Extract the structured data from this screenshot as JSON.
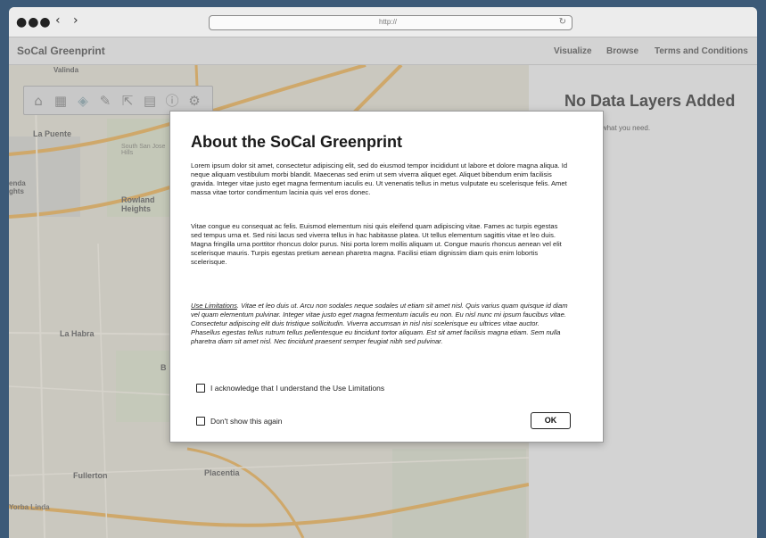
{
  "browser": {
    "dots": "●●●",
    "back": "‹",
    "forward": "›",
    "url": "http://",
    "reload_icon": "↻"
  },
  "app": {
    "title": "SoCal Greenprint",
    "nav": [
      "Visualize",
      "Browse",
      "Terms and Conditions"
    ]
  },
  "map": {
    "labels": [
      "Valinda",
      "La Puente",
      "South San Jose Hills",
      "enda ghts",
      "Rowland Heights",
      "La Habra",
      "Fullerton",
      "Placentia",
      "B",
      "Yorba Linda"
    ],
    "toolbar_icons": [
      "home-icon",
      "basemap-icon",
      "layers-icon",
      "draw-icon",
      "export-icon",
      "calculator-icon",
      "info-icon",
      "settings-icon"
    ]
  },
  "panel": {
    "title": "No Data Layers Added",
    "subtitle": "ailable datasets to find what you need."
  },
  "modal": {
    "title": "About the SoCal Greenprint",
    "para1": "Lorem ipsum dolor sit amet, consectetur adipiscing elit, sed do eiusmod tempor incididunt ut labore et dolore magna aliqua. Id neque aliquam vestibulum morbi blandit. Maecenas sed enim ut sem viverra aliquet eget. Aliquet bibendum enim facilisis gravida. Integer vitae justo eget magna fermentum iaculis eu. Ut venenatis tellus in metus vulputate eu scelerisque felis. Amet massa vitae tortor condimentum lacinia quis vel eros donec.",
    "para2": "Vitae congue eu consequat ac felis. Euismod elementum nisi quis eleifend quam adipiscing vitae. Fames ac turpis egestas sed tempus urna et. Sed nisi lacus sed viverra tellus in hac habitasse platea. Ut tellus elementum sagittis vitae et leo duis. Magna fringilla urna porttitor rhoncus dolor purus. Nisi porta lorem mollis aliquam ut. Congue mauris rhoncus aenean vel elit scelerisque mauris. Turpis egestas pretium aenean pharetra magna. Facilisi etiam dignissim diam quis enim lobortis scelerisque.",
    "use_limitations_link": "Use Limitations",
    "para3": ". Vitae et leo duis ut. Arcu non sodales neque sodales ut etiam sit amet nisl. Quis varius quam quisque id diam vel quam elementum pulvinar. Integer vitae justo eget magna fermentum iaculis eu non. Eu nisl nunc mi ipsum faucibus vitae. Consectetur adipiscing elit duis tristique sollicitudin. Viverra accumsan in nisl nisi scelerisque eu ultrices vitae auctor. Phasellus egestas tellus rutrum tellus pellentesque eu tincidunt tortor aliquam. Est sit amet facilisis magna etiam. Sem nulla pharetra diam sit amet nisl. Nec tincidunt praesent semper feugiat nibh sed pulvinar.",
    "acknowledge_label": "I acknowledge that I understand the Use Limitations",
    "dont_show_label": "Don't show this again",
    "ok_label": "OK"
  }
}
